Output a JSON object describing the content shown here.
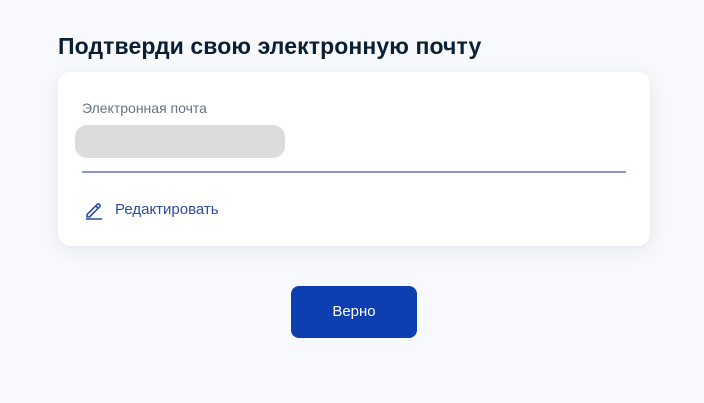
{
  "page": {
    "title": "Подтверди свою электронную почту"
  },
  "email_field": {
    "label": "Электронная почта",
    "value": ""
  },
  "edit": {
    "label": "Редактировать",
    "icon": "pencil-icon"
  },
  "confirm": {
    "label": "Верно"
  },
  "colors": {
    "background": "#f7f9fc",
    "card": "#ffffff",
    "title": "#0b1f33",
    "label": "#66727f",
    "redacted": "#dcdcdc",
    "underline": "#8b98cf",
    "link": "#2d4da3",
    "button": "#0d3fb0",
    "button_text": "#ffffff"
  }
}
